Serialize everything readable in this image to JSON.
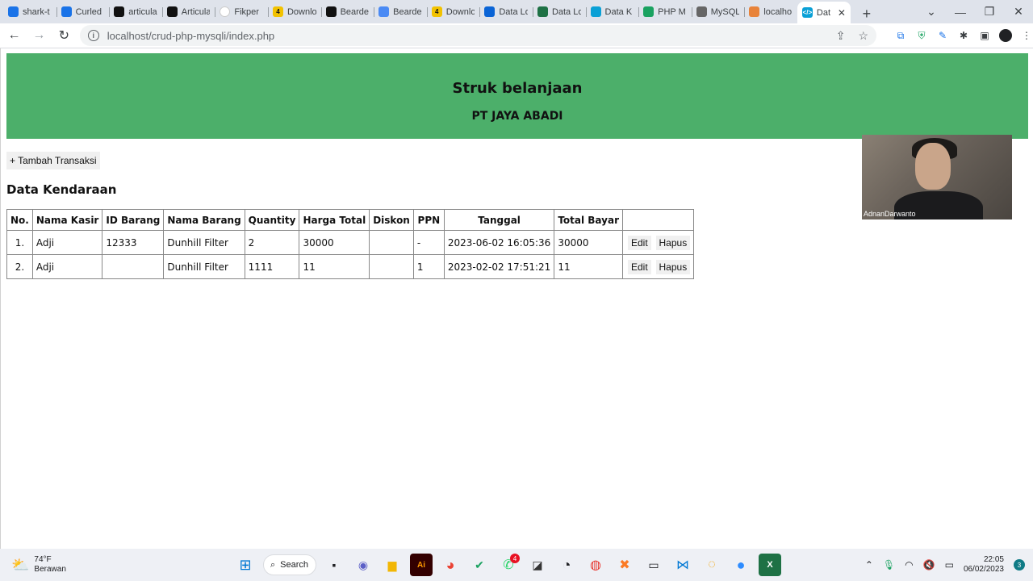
{
  "browser": {
    "tabs": [
      {
        "label": "shark-t",
        "icon": "globe-icon",
        "color": "#1a73e8"
      },
      {
        "label": "Curled",
        "icon": "globe-icon",
        "color": "#1a73e8"
      },
      {
        "label": "articula",
        "icon": "articulate-icon",
        "color": "#111111"
      },
      {
        "label": "Articula",
        "icon": "articulate-icon",
        "color": "#111111"
      },
      {
        "label": "Fikper",
        "icon": "fikper-icon",
        "color": "#ffffff"
      },
      {
        "label": "Downlo",
        "icon": "download-4-icon",
        "color": "#f2c200"
      },
      {
        "label": "Bearde",
        "icon": "articulate-icon",
        "color": "#111111"
      },
      {
        "label": "Bearde",
        "icon": "cloud-icon",
        "color": "#4a8af4"
      },
      {
        "label": "Downlo",
        "icon": "download-4-icon",
        "color": "#f2c200"
      },
      {
        "label": "Data Lo",
        "icon": "onedrive-icon",
        "color": "#0a64d6"
      },
      {
        "label": "Data Lo",
        "icon": "excel-icon",
        "color": "#1e7145"
      },
      {
        "label": "Data K",
        "icon": "code-icon",
        "color": "#0aa0d6"
      },
      {
        "label": "PHP M",
        "icon": "w-icon",
        "color": "#1aa260"
      },
      {
        "label": "MySQL",
        "icon": "mysql-icon",
        "color": "#666666"
      },
      {
        "label": "localho",
        "icon": "localhost-icon",
        "color": "#e8833a"
      }
    ],
    "active_tab": {
      "label": "Dat",
      "icon": "code-icon",
      "color": "#0aa0d6"
    },
    "url": "localhost/crud-php-mysqli/index.php"
  },
  "page": {
    "title": "Struk belanjaan",
    "company": "PT JAYA ABADI",
    "add_button": "+ Tambah Transaksi",
    "section_title": "Data Kendaraan",
    "columns": [
      "No.",
      "Nama Kasir",
      "ID Barang",
      "Nama Barang",
      "Quantity",
      "Harga Total",
      "Diskon",
      "PPN",
      "Tanggal",
      "Total Bayar",
      ""
    ],
    "rows": [
      {
        "no": "1.",
        "kasir": "Adji",
        "id_barang": "12333",
        "nama_barang": "Dunhill Filter",
        "quantity": "2",
        "harga_total": "30000",
        "diskon": "",
        "ppn": "-",
        "tanggal": "2023-06-02 16:05:36",
        "total_bayar": "30000",
        "edit": "Edit",
        "hapus": "Hapus"
      },
      {
        "no": "2.",
        "kasir": "Adji",
        "id_barang": "",
        "nama_barang": "Dunhill Filter",
        "quantity": "1111",
        "harga_total": "11",
        "diskon": "",
        "ppn": "1",
        "tanggal": "2023-02-02 17:51:21",
        "total_bayar": "11",
        "edit": "Edit",
        "hapus": "Hapus"
      }
    ],
    "header_color": "#4caf6a"
  },
  "webcam": {
    "name": "AdnanDarwanto"
  },
  "taskbar": {
    "weather_temp": "74°F",
    "weather_desc": "Berawan",
    "search_label": "Search",
    "whatsapp_badge": "4",
    "time": "22:05",
    "date": "06/02/2023",
    "notifications": "3"
  }
}
